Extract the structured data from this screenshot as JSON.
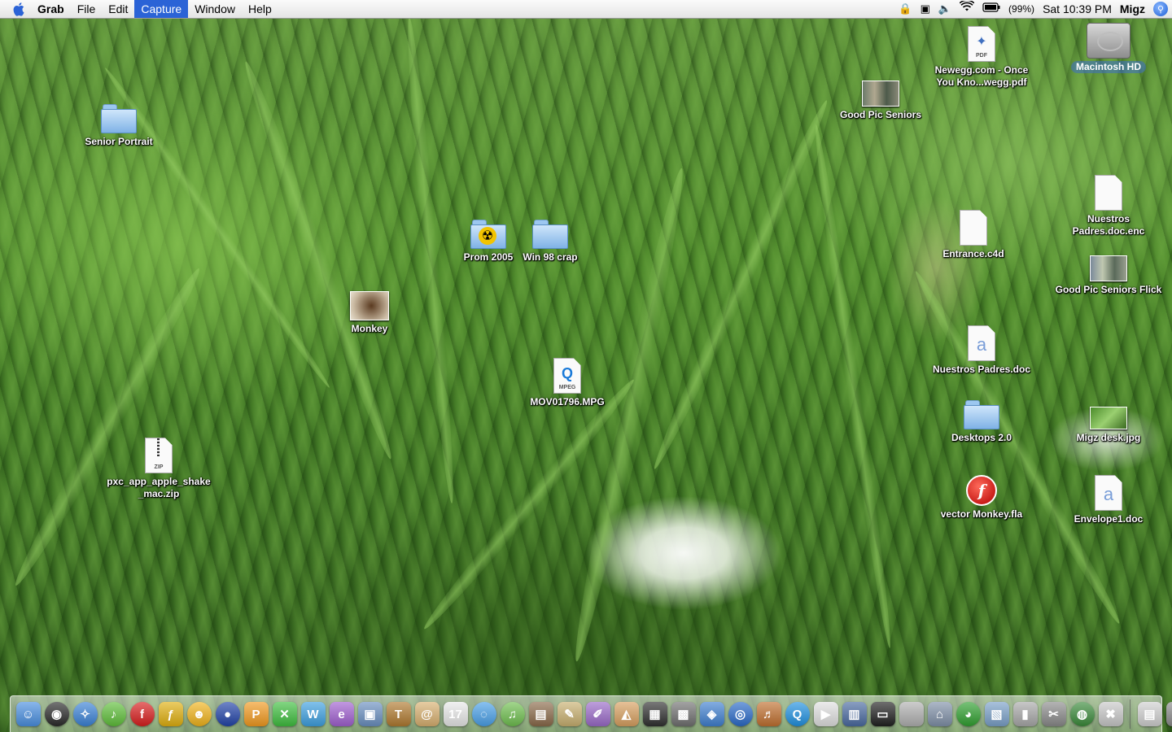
{
  "menubar": {
    "app_name": "Grab",
    "menus": [
      "File",
      "Edit",
      "Capture",
      "Window",
      "Help"
    ],
    "active_menu": "Capture",
    "battery_percent": "(99%)",
    "clock": "Sat 10:39 PM",
    "user": "Migz",
    "status_icons": [
      "lock-icon",
      "display-icon",
      "volume-icon",
      "wifi-icon",
      "battery-icon",
      "spotlight-icon"
    ]
  },
  "desktop": {
    "icons": [
      {
        "label": "Macintosh HD",
        "kind": "hard-drive",
        "selected": true
      },
      {
        "label": "Newegg.com - Once\nYou Kno...wegg.pdf",
        "kind": "pdf"
      },
      {
        "label": "Good Pic Seniors",
        "kind": "photo"
      },
      {
        "label": "Senior Portrait",
        "kind": "folder"
      },
      {
        "label": "Nuestros\nPadres.doc.enc",
        "kind": "document"
      },
      {
        "label": "Entrance.c4d",
        "kind": "document"
      },
      {
        "label": "Good Pic Seniors Flick",
        "kind": "photo"
      },
      {
        "label": "Prom 2005",
        "kind": "folder-radiation"
      },
      {
        "label": "Win 98 crap",
        "kind": "folder"
      },
      {
        "label": "Monkey",
        "kind": "photo"
      },
      {
        "label": "Nuestros Padres.doc",
        "kind": "word-doc"
      },
      {
        "label": "MOV01796.MPG",
        "kind": "mpeg"
      },
      {
        "label": "Desktops 2.0",
        "kind": "folder"
      },
      {
        "label": "Migz desk.jpg",
        "kind": "photo"
      },
      {
        "label": "pxc_app_apple_shake\n_mac.zip",
        "kind": "zip"
      },
      {
        "label": "vector Monkey.fla",
        "kind": "flash"
      },
      {
        "label": "Envelope1.doc",
        "kind": "word-doc"
      }
    ]
  },
  "dock": {
    "items": [
      {
        "name": "finder-icon",
        "color": "#4a8fe0",
        "glyph": "☺"
      },
      {
        "name": "dashboard-icon",
        "color": "#2a2a2a",
        "glyph": "◉"
      },
      {
        "name": "safari-icon",
        "color": "#3b82d6",
        "glyph": "✧"
      },
      {
        "name": "itunes-icon",
        "color": "#5fbf3a",
        "glyph": "♪"
      },
      {
        "name": "flash-icon",
        "color": "#d81e1e",
        "glyph": "f"
      },
      {
        "name": "dreamweaver-icon",
        "color": "#e0b010",
        "glyph": "ƒ"
      },
      {
        "name": "smiley-app-icon",
        "color": "#f1b41c",
        "glyph": "☻"
      },
      {
        "name": "sphere-app-icon",
        "color": "#2243a8",
        "glyph": "●"
      },
      {
        "name": "p-app-icon",
        "color": "#f29a20",
        "glyph": "P"
      },
      {
        "name": "x-app-icon",
        "color": "#3fbf3f",
        "glyph": "✕"
      },
      {
        "name": "w-app-icon",
        "color": "#3ea0e0",
        "glyph": "W"
      },
      {
        "name": "e-app-icon",
        "color": "#a060d0",
        "glyph": "e"
      },
      {
        "name": "preview-icon",
        "color": "#6a8fc0",
        "glyph": "▣"
      },
      {
        "name": "t-tool-icon",
        "color": "#b07a30",
        "glyph": "T"
      },
      {
        "name": "address-book-icon",
        "color": "#d8b070",
        "glyph": "@"
      },
      {
        "name": "ical-icon",
        "color": "#e8e8e8",
        "glyph": "17"
      },
      {
        "name": "ichat-icon",
        "color": "#4aa0e8",
        "glyph": "◌"
      },
      {
        "name": "itunes-note-icon",
        "color": "#6fbf4f",
        "glyph": "♫"
      },
      {
        "name": "iphoto-icon",
        "color": "#8a6a4a",
        "glyph": "▤"
      },
      {
        "name": "pen-tool-icon",
        "color": "#c8b070",
        "glyph": "✎"
      },
      {
        "name": "pens-icon",
        "color": "#9a6ac8",
        "glyph": "✐"
      },
      {
        "name": "sketch-icon",
        "color": "#d8a060",
        "glyph": "◭"
      },
      {
        "name": "clapper-icon",
        "color": "#303030",
        "glyph": "▦"
      },
      {
        "name": "movie-icon",
        "color": "#707070",
        "glyph": "▩"
      },
      {
        "name": "idvd-icon",
        "color": "#4080d0",
        "glyph": "◈"
      },
      {
        "name": "dvd-player-icon",
        "color": "#2a6ac8",
        "glyph": "◎"
      },
      {
        "name": "garageband-icon",
        "color": "#c07030",
        "glyph": "♬"
      },
      {
        "name": "quicktime-icon",
        "color": "#2090e0",
        "glyph": "Q"
      },
      {
        "name": "camera-icon",
        "color": "#e0e0e0",
        "glyph": "▶"
      },
      {
        "name": "film-strip-icon",
        "color": "#4a6aa0",
        "glyph": "▥"
      },
      {
        "name": "monitor-icon",
        "color": "#202020",
        "glyph": "▭"
      },
      {
        "name": "apple-icon",
        "color": "#b0b0b0",
        "glyph": ""
      },
      {
        "name": "network-icon",
        "color": "#8090a8",
        "glyph": "⌂"
      },
      {
        "name": "color-wheel-icon",
        "color": "#30a030",
        "glyph": "◕"
      },
      {
        "name": "archive-icon",
        "color": "#7aa0c8",
        "glyph": "▧"
      },
      {
        "name": "server-icon",
        "color": "#a8a8a8",
        "glyph": "▮"
      },
      {
        "name": "utilities-icon",
        "color": "#8a8a8a",
        "glyph": "✂"
      },
      {
        "name": "globe-icon",
        "color": "#3a8a3a",
        "glyph": "◍"
      },
      {
        "name": "tools-icon",
        "color": "#c8c8c8",
        "glyph": "✖"
      }
    ],
    "right_items": [
      {
        "name": "documents-stack-icon",
        "color": "#d0d0d0",
        "glyph": "▤"
      },
      {
        "name": "trash-icon",
        "color": "#8a8a8a",
        "glyph": "♲"
      }
    ]
  }
}
